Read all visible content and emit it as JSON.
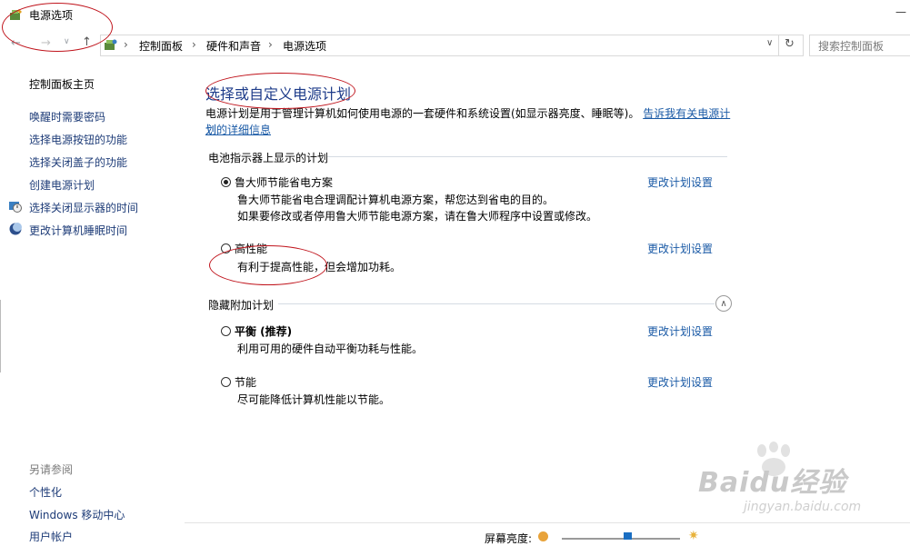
{
  "window": {
    "title": "电源选项",
    "minimize_glyph": "—"
  },
  "address_bar": {
    "breadcrumbs": [
      "控制面板",
      "硬件和声音",
      "电源选项"
    ],
    "separator": "›",
    "search_placeholder": "搜索控制面板"
  },
  "sidebar": {
    "home": "控制面板主页",
    "items": [
      {
        "label": "唤醒时需要密码"
      },
      {
        "label": "选择电源按钮的功能"
      },
      {
        "label": "选择关闭盖子的功能"
      },
      {
        "label": "创建电源计划"
      },
      {
        "label": "选择关闭显示器的时间"
      },
      {
        "label": "更改计算机睡眠时间"
      }
    ],
    "see_also_title": "另请参阅",
    "see_also": [
      {
        "label": "个性化"
      },
      {
        "label": "Windows 移动中心"
      },
      {
        "label": "用户帐户"
      }
    ]
  },
  "main": {
    "heading": "选择或自定义电源计划",
    "intro_text": "电源计划是用于管理计算机如何使用电源的一套硬件和系统设置(如显示器亮度、睡眠等)。",
    "intro_link_part1": "告诉我有关电源计划",
    "intro_link_part2": "划的详细信息",
    "battery_section_title": "电池指示器上显示的计划",
    "hidden_section_title": "隐藏附加计划",
    "change_plan_label": "更改计划设置",
    "plans": [
      {
        "name": "鲁大师节能省电方案",
        "selected": true,
        "desc1": "鲁大师节能省电合理调配计算机电源方案，帮您达到省电的目的。",
        "desc2": "如果要修改或者停用鲁大师节能电源方案，请在鲁大师程序中设置或修改。"
      },
      {
        "name": "高性能",
        "selected": false,
        "desc1": "有利于提高性能，但会增加功耗。"
      }
    ],
    "hidden_plans": [
      {
        "name": "平衡 (推荐)",
        "selected": false,
        "desc1": "利用可用的硬件自动平衡功耗与性能。"
      },
      {
        "name": "节能",
        "selected": false,
        "desc1": "尽可能降低计算机性能以节能。"
      }
    ]
  },
  "footer": {
    "brightness_label": "屏幕亮度:",
    "brightness_level": 0.55
  },
  "watermark": {
    "brand": "Baidu经验",
    "url": "jingyan.baidu.com"
  },
  "colors": {
    "link": "#1a5aa6",
    "annotation": "#c0141c"
  }
}
